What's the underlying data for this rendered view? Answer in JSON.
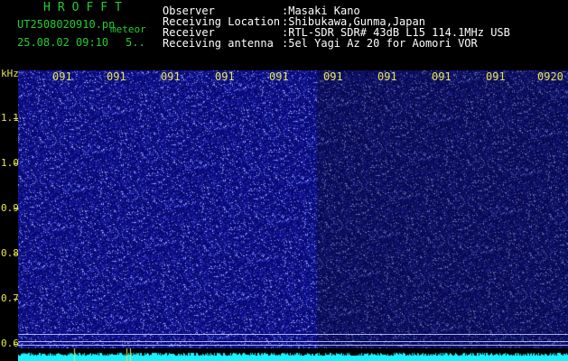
{
  "header": {
    "logo": "HROFFT",
    "filename": "UT2508020910.pn",
    "tag": "meteor",
    "datetime": "25.08.02 09:10",
    "count": "5..",
    "fields": [
      {
        "label": "Observer",
        "value": ":Masaki Kano"
      },
      {
        "label": "Receiving Location",
        "value": ":Shibukawa,Gunma,Japan"
      },
      {
        "label": "Receiver",
        "value": ":RTL-SDR SDR# 43dB L15 114.1MHz USB"
      },
      {
        "label": "Receiving antenna",
        "value": ":5el Yagi Az 20 for Aomori VOR"
      }
    ]
  },
  "axis": {
    "unit": "kHz",
    "y_labels": [
      "1.1",
      "1.0",
      "0.9",
      "0.8",
      "0.7",
      "0.6"
    ],
    "x_labels": [
      "091",
      "091",
      "091",
      "091",
      "091",
      "091",
      "091",
      "091",
      "091",
      "0920"
    ]
  },
  "colors": {
    "background": "#000000",
    "spectrum_base": "#0a0a78",
    "noise_light": "#9aa8ff",
    "trace": "#19f2ff",
    "label_yellow": "#e8e64a",
    "logo_green": "#22cc33"
  }
}
